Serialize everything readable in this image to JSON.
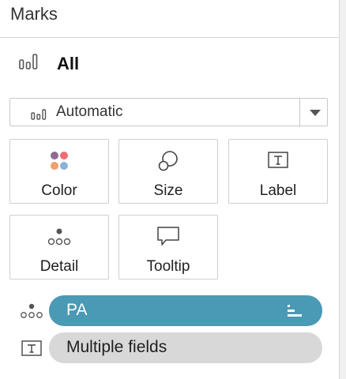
{
  "marks": {
    "title": "Marks"
  },
  "all_row": {
    "label": "All",
    "icon": "bar-chart-icon"
  },
  "mark_type": {
    "value": "Automatic",
    "icon": "bar-chart-icon"
  },
  "cards": [
    {
      "label": "Color",
      "icon": "color-dots-icon"
    },
    {
      "label": "Size",
      "icon": "size-circles-icon"
    },
    {
      "label": "Label",
      "icon": "text-box-icon"
    },
    {
      "label": "Detail",
      "icon": "detail-dots-icon"
    },
    {
      "label": "Tooltip",
      "icon": "speech-bubble-icon"
    }
  ],
  "pills": [
    {
      "label": "PA",
      "role_icon": "detail-dots-icon",
      "sort_icon": "sort-descending-icon",
      "color": "#4a99b5"
    },
    {
      "label": "Multiple fields",
      "role_icon": "text-box-icon",
      "color": "#d8d8d8"
    }
  ],
  "colors": {
    "color_dots": [
      "#8e6a93",
      "#ef6b73",
      "#f0a06a",
      "#8fb0d6"
    ]
  }
}
